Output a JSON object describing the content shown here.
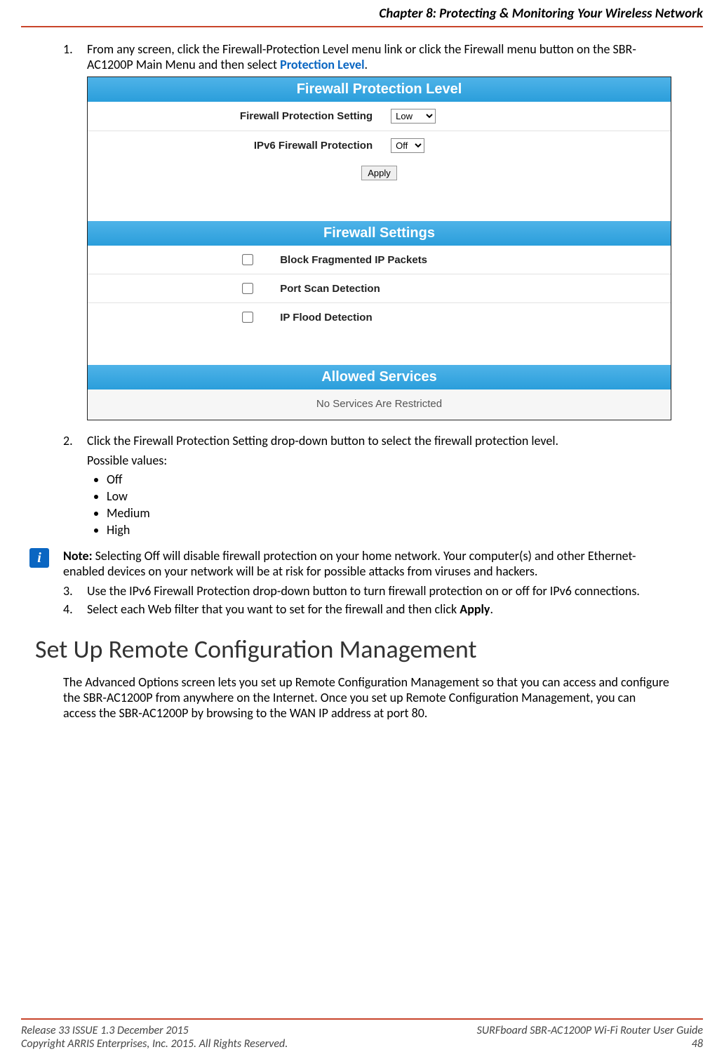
{
  "header": {
    "chapter": "Chapter 8: Protecting & Monitoring Your Wireless Network"
  },
  "steps": {
    "s1_num": "1.",
    "s1_text_a": "From any screen, click the Firewall-Protection Level menu link or click the Firewall menu button on the SBR-AC1200P Main Menu and then select ",
    "s1_link": "Protection Level",
    "s1_text_b": ".",
    "s2_num": "2.",
    "s2_text": "Click the Firewall Protection Setting drop-down button to select the firewall protection level.",
    "s2_sub": "Possible values:",
    "bullets": {
      "b1": "Off",
      "b2": "Low",
      "b3": "Medium",
      "b4": "High"
    },
    "s3_num": "3.",
    "s3_text": "Use the IPv6 Firewall Protection drop-down button to turn firewall protection on or off for IPv6 connections.",
    "s4_num": "4.",
    "s4_text_a": "Select each Web filter that you want to set for the firewall and then click ",
    "s4_bold": "Apply",
    "s4_text_b": "."
  },
  "router": {
    "title1": "Firewall Protection Level",
    "label1": "Firewall Protection Setting",
    "select1_value": "Low",
    "label2": "IPv6 Firewall Protection",
    "select2_value": "Off",
    "apply": "Apply",
    "title2": "Firewall Settings",
    "cb1": "Block Fragmented IP Packets",
    "cb2": "Port Scan Detection",
    "cb3": "IP Flood Detection",
    "title3": "Allowed Services",
    "allowed_msg": "No Services Are Restricted"
  },
  "note": {
    "icon_glyph": "i",
    "label": "Note:",
    "text": " Selecting Off will disable firewall protection on your home network. Your computer(s) and other Ethernet-enabled devices on your network will be at risk for possible attacks from viruses and hackers."
  },
  "heading": "Set Up Remote Configuration Management",
  "body_p": "The Advanced Options screen lets you set up Remote Configuration Management so that you can access and configure the SBR-AC1200P from anywhere on the Internet. Once you set up Remote Configuration Management, you can access the SBR-AC1200P by browsing to the WAN IP address at port 80.",
  "footer": {
    "left1": "Release 33 ISSUE 1.3    December 2015",
    "left2": "Copyright ARRIS Enterprises, Inc. 2015. All Rights Reserved.",
    "right1": "SURFboard SBR‑AC1200P Wi-Fi Router User Guide",
    "right2": "48"
  }
}
